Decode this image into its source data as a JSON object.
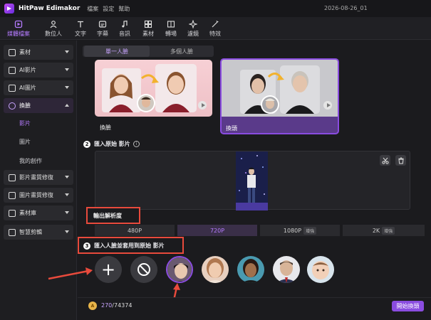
{
  "app": {
    "name": "HitPaw Edimakor",
    "menu": [
      "檔案",
      "設定",
      "幫助"
    ],
    "date_stamp": "2026-08-26_01"
  },
  "toolbar": [
    {
      "label": "媒體檔案",
      "icon": "media-icon",
      "active": true
    },
    {
      "label": "數位人",
      "icon": "digital-human-icon"
    },
    {
      "label": "文字",
      "icon": "text-icon"
    },
    {
      "label": "字幕",
      "icon": "subtitle-icon"
    },
    {
      "label": "音訊",
      "icon": "music-icon"
    },
    {
      "label": "素材",
      "icon": "material-icon"
    },
    {
      "label": "轉場",
      "icon": "transition-icon"
    },
    {
      "label": "濾鏡",
      "icon": "filter-icon"
    },
    {
      "label": "特效",
      "icon": "effects-icon"
    }
  ],
  "sidebar": {
    "items": [
      {
        "label": "素材"
      },
      {
        "label": "AI影片"
      },
      {
        "label": "AI圖片"
      },
      {
        "label": "換臉",
        "active": true
      },
      {
        "label": "影片畫質修復"
      },
      {
        "label": "圖片畫質修復"
      },
      {
        "label": "素材庫"
      },
      {
        "label": "智慧剪輯"
      }
    ],
    "sub_items": [
      {
        "label": "影片",
        "active": true
      },
      {
        "label": "圖片"
      },
      {
        "label": "我的創作"
      }
    ]
  },
  "tabs": [
    "單一人臉",
    "多個人臉"
  ],
  "modes": [
    {
      "label": "換臉",
      "selected": false
    },
    {
      "label": "換頭",
      "selected": true
    }
  ],
  "step2": {
    "number": "2",
    "title": "匯入原始 影片",
    "info": "i"
  },
  "output": {
    "title": "輸出解析度",
    "options": [
      {
        "label": "480P",
        "badge": ""
      },
      {
        "label": "720P",
        "badge": "",
        "active": true
      },
      {
        "label": "1080P",
        "badge": "增強"
      },
      {
        "label": "2K",
        "badge": "增強"
      }
    ]
  },
  "step3": {
    "number": "3",
    "title": "匯入人臉並套用到原始 影片"
  },
  "faces": {
    "add_symbol": "+",
    "items": [
      "face-1",
      "face-2",
      "face-3",
      "face-4",
      "face-5"
    ]
  },
  "footer": {
    "coin": "A",
    "credits_used": "270",
    "credits_total": "/74374",
    "start_label": "開始換頭"
  },
  "colors": {
    "accent": "#8a4ce0",
    "accent_text": "#b57bff",
    "annotation_red": "#e84a3c"
  }
}
